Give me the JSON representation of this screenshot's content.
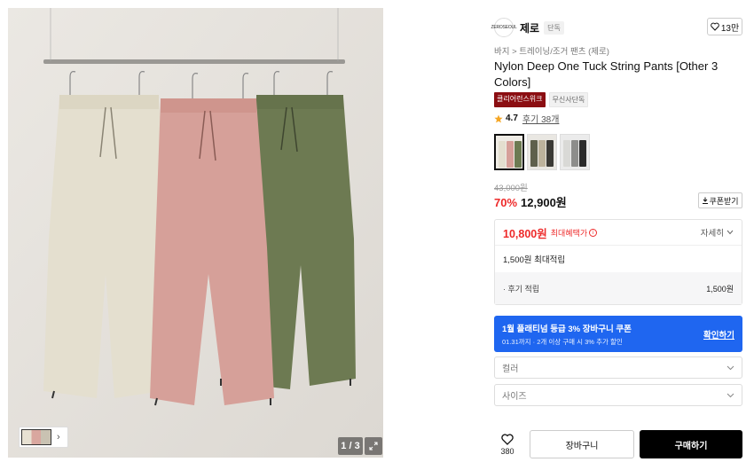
{
  "gallery": {
    "counter": "1 / 3",
    "thumbnail_next": "›"
  },
  "brand": {
    "logo_text": "ZEROSEOUL",
    "name": "제로",
    "tag": "단독",
    "likes": "13만"
  },
  "breadcrumb": "바지 > 트레이닝/조거 팬츠 (제로)",
  "product": {
    "title": "Nylon Deep One Tuck String Pants [Other 3 Colors]",
    "badges": [
      "클리어런스위크",
      "무신사단독"
    ]
  },
  "rating": {
    "score": "4.7",
    "reviews": "후기 38개"
  },
  "colors": {
    "accent_red": "#ee2b2b",
    "promo_blue": "#1f66f0",
    "badge_red": "#8b0e12"
  },
  "price": {
    "original": "43,000원",
    "discount": "70%",
    "sale": "12,900원",
    "coupon_label": "쿠폰받기"
  },
  "benefit": {
    "max_price": "10,800원",
    "max_label": "최대혜택가",
    "detail_label": "자세히",
    "points": "1,500원 최대적립",
    "review_points_label": "· 후기 적립",
    "review_points_value": "1,500원"
  },
  "promo": {
    "title": "1월 플래티넘 등급 3% 장바구니 쿠폰",
    "subtitle": "01.31까지 · 2개 이상 구매 시 3% 추가 할인",
    "link": "확인하기"
  },
  "options": {
    "color_placeholder": "컬러",
    "size_placeholder": "사이즈"
  },
  "actions": {
    "wish_count": "380",
    "cart": "장바구니",
    "buy": "구매하기"
  }
}
